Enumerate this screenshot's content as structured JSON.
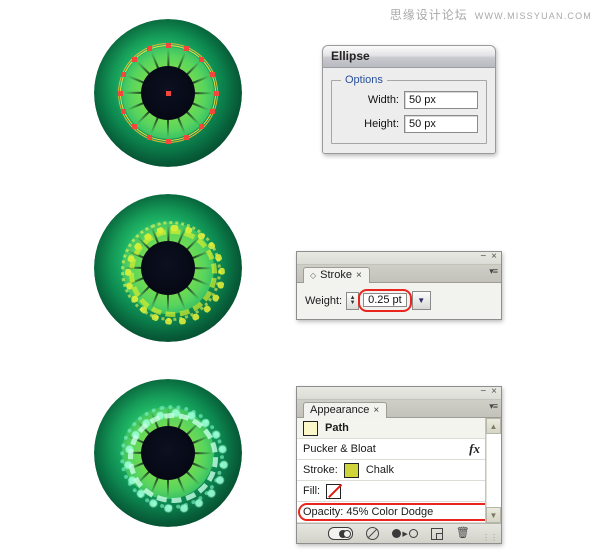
{
  "watermark": {
    "cn": "思缘设计论坛",
    "url": "WWW.MISSYUAN.COM"
  },
  "ellipse_dialog": {
    "title": "Ellipse",
    "options_legend": "Options",
    "fields": [
      {
        "label": "Width:",
        "value": "50 px"
      },
      {
        "label": "Height:",
        "value": "50 px"
      }
    ]
  },
  "stroke_panel": {
    "tab_label": "Stroke",
    "tab_close": "×",
    "tab_diamond": "◇",
    "minimize": "−",
    "close": "×",
    "menu": "▾≡",
    "weight_label": "Weight:",
    "weight_value": "0.25 pt",
    "spin_up": "▲",
    "spin_down": "▼",
    "dropdown_caret": "▼",
    "highlight_color": "#e8251e"
  },
  "appearance_panel": {
    "tab_label": "Appearance",
    "tab_close": "×",
    "minimize": "−",
    "close": "×",
    "menu": "▾≡",
    "rows": [
      {
        "name": "path",
        "label": "Path",
        "swatch": "pale"
      },
      {
        "name": "pucker-bloat",
        "label": "Pucker & Bloat",
        "fx": "fx"
      },
      {
        "name": "stroke",
        "label": "Stroke:",
        "swatch": "olive",
        "value": "Chalk"
      },
      {
        "name": "fill",
        "label": "Fill:",
        "swatch": "none",
        "value": ""
      },
      {
        "name": "opacity",
        "label": "Opacity: 45% Color Dodge",
        "highlighted": true
      }
    ],
    "scroll_up": "▲",
    "scroll_down": "▼",
    "footer_icons": [
      "new-art-has-basic-appearance-toggle",
      "clear-appearance-icon",
      "reduce-to-basic-appearance-icon",
      "duplicate-item-icon",
      "delete-item-icon"
    ],
    "trash_glyph": "Ὕ1",
    "grip": "⋮⋮",
    "highlight_color": "#e8251e"
  },
  "eyes": [
    {
      "name": "eye-step-1",
      "caption": "",
      "has_selection_path": true,
      "ring_style": "none",
      "anchor_count": 16,
      "anchor_color": "#f4463c"
    },
    {
      "name": "eye-step-2",
      "caption": "",
      "has_selection_path": false,
      "ring_style": "yellow-chalk"
    },
    {
      "name": "eye-step-3",
      "caption": "",
      "has_selection_path": false,
      "ring_style": "cyan-color-dodge"
    }
  ],
  "iris": {
    "spoke_count": 16,
    "pupil_color": "#070a16",
    "iris_color": "#7fe04a",
    "sclera_color": "#0f9d5c"
  }
}
